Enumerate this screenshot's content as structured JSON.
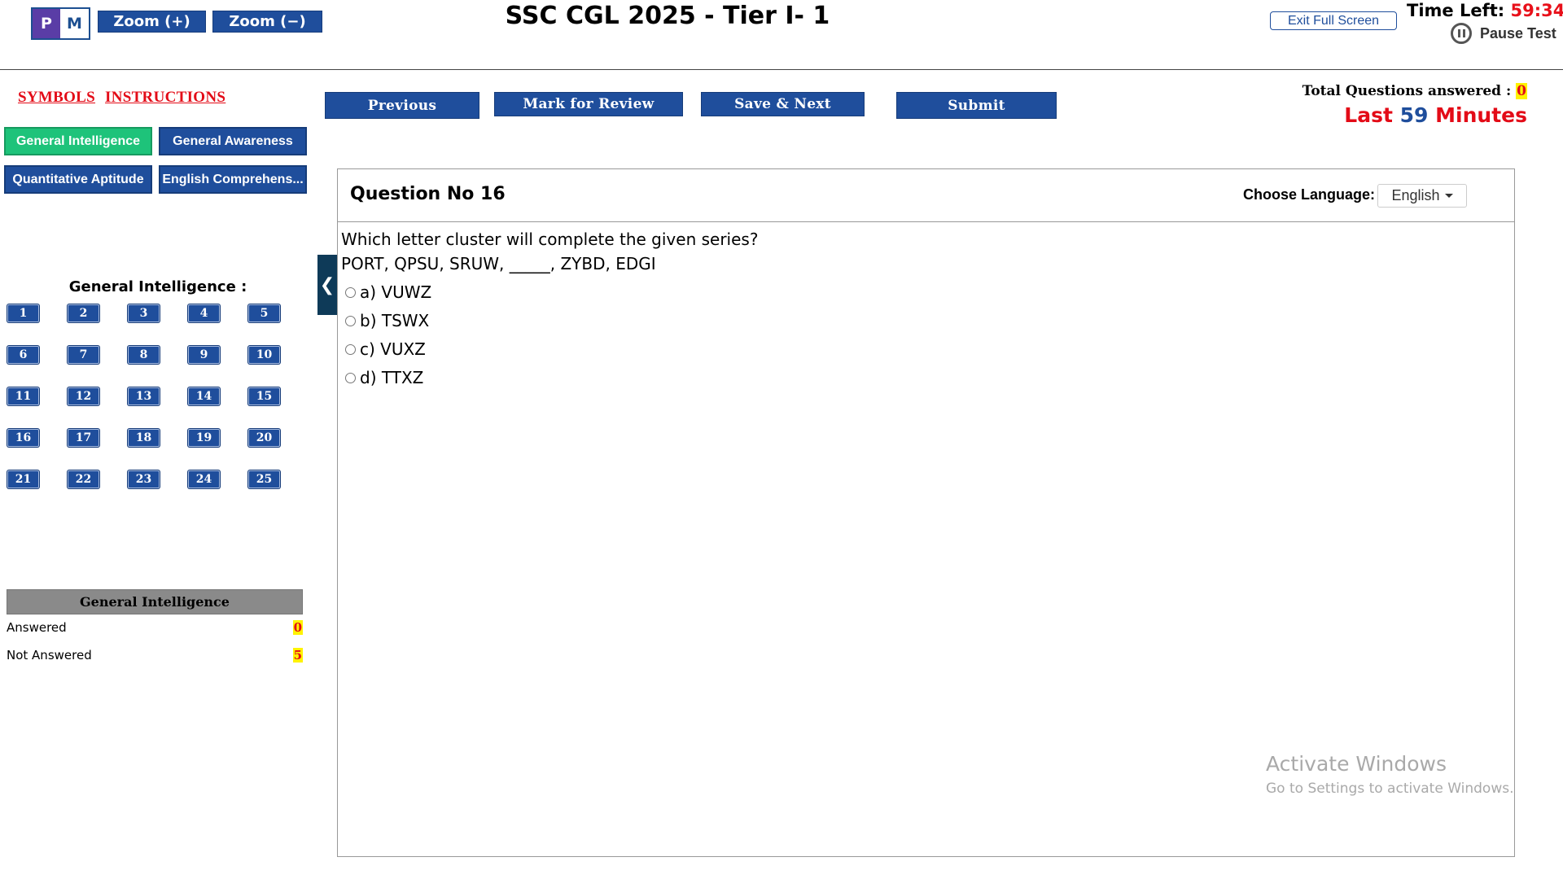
{
  "header": {
    "logo_left": "P",
    "logo_right": "M",
    "zoom_in": "Zoom (+)",
    "zoom_out": "Zoom (−)",
    "title": "SSC CGL 2025 - Tier I- 1",
    "exit_fullscreen": "Exit Full Screen",
    "time_left_label": "Time Left:",
    "time_left_value": "59:34",
    "pause_label": "Pause Test"
  },
  "left": {
    "symbols_link": "SYMBOLS",
    "instructions_link": "INSTRUCTIONS",
    "sections": [
      {
        "label": "General Intelligence",
        "active": true
      },
      {
        "label": "General Awareness",
        "active": false
      },
      {
        "label": "Quantitative Aptitude",
        "active": false
      },
      {
        "label": "English Comprehens...",
        "active": false
      }
    ],
    "current_section_label": "General Intelligence :",
    "question_numbers": [
      "1",
      "2",
      "3",
      "4",
      "5",
      "6",
      "7",
      "8",
      "9",
      "10",
      "11",
      "12",
      "13",
      "14",
      "15",
      "16",
      "17",
      "18",
      "19",
      "20",
      "21",
      "22",
      "23",
      "24",
      "25"
    ],
    "summary": {
      "title": "General Intelligence",
      "answered_label": "Answered",
      "answered_value": "0",
      "not_answered_label": "Not Answered",
      "not_answered_value": "5"
    }
  },
  "actions": {
    "previous": "Previous",
    "mark_review": "Mark for Review",
    "save_next": "Save & Next",
    "submit": "Submit"
  },
  "status": {
    "total_answered_label": "Total Questions answered :",
    "total_answered_value": "0",
    "last_prefix": "Last",
    "last_number": "59",
    "last_suffix": "Minutes"
  },
  "question": {
    "number_label": "Question No 16",
    "choose_language_label": "Choose Language:",
    "language_value": "English",
    "line1": "Which letter cluster will complete the given series?",
    "line2": "PORT, QPSU, SRUW, _____, ZYBD, EDGI",
    "options": [
      "a) VUWZ",
      "b) TSWX",
      "c) VUXZ",
      "d) TTXZ"
    ]
  },
  "watermark": {
    "line1": "Activate Windows",
    "line2": "Go to Settings to activate Windows."
  },
  "colors": {
    "primary_blue": "#1f4e9c",
    "active_green": "#1ec37a",
    "alert_red": "#e30b17",
    "highlight_yellow": "#fff200"
  }
}
